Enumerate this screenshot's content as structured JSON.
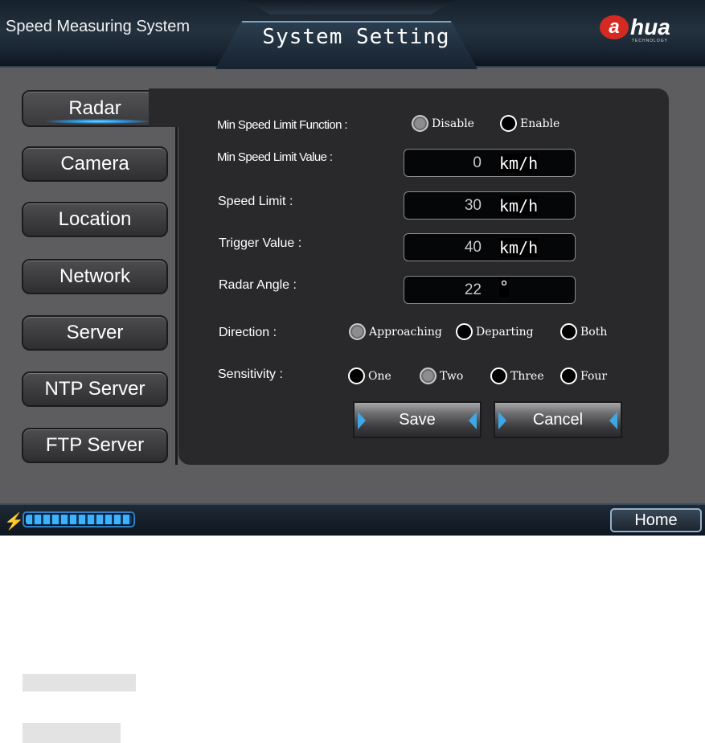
{
  "header": {
    "app_title": "Speed Measuring System",
    "screen_title": "System Setting",
    "logo": {
      "mark": "a",
      "text": "hua",
      "subtext": "TECHNOLOGY"
    }
  },
  "nav": {
    "items": [
      {
        "label": "Radar",
        "active": true
      },
      {
        "label": "Camera"
      },
      {
        "label": "Location"
      },
      {
        "label": "Network"
      },
      {
        "label": "Server"
      },
      {
        "label": "NTP Server"
      },
      {
        "label": "FTP Server"
      }
    ]
  },
  "form": {
    "min_speed_function": {
      "label": "Min Speed Limit Function :",
      "options": [
        "Disable",
        "Enable"
      ],
      "selected": "Disable"
    },
    "min_speed_value": {
      "label": "Min Speed Limit Value :",
      "value": "0",
      "unit": "km/h"
    },
    "speed_limit": {
      "label": "Speed Limit :",
      "value": "30",
      "unit": "km/h"
    },
    "trigger_value": {
      "label": "Trigger Value :",
      "value": "40",
      "unit": "km/h"
    },
    "radar_angle": {
      "label": "Radar Angle :",
      "value": "22",
      "unit": "°"
    },
    "direction": {
      "label": "Direction :",
      "options": [
        "Approaching",
        "Departing",
        "Both"
      ],
      "selected": "Approaching"
    },
    "sensitivity": {
      "label": "Sensitivity :",
      "options": [
        "One",
        "Two",
        "Three",
        "Four"
      ],
      "selected": "Two"
    }
  },
  "actions": {
    "save": "Save",
    "cancel": "Cancel"
  },
  "footer": {
    "home": "Home",
    "progress": 1.0
  },
  "colors": {
    "accent": "#3fa6e8",
    "panel": "#29292b",
    "background": "#5d5d5f"
  }
}
